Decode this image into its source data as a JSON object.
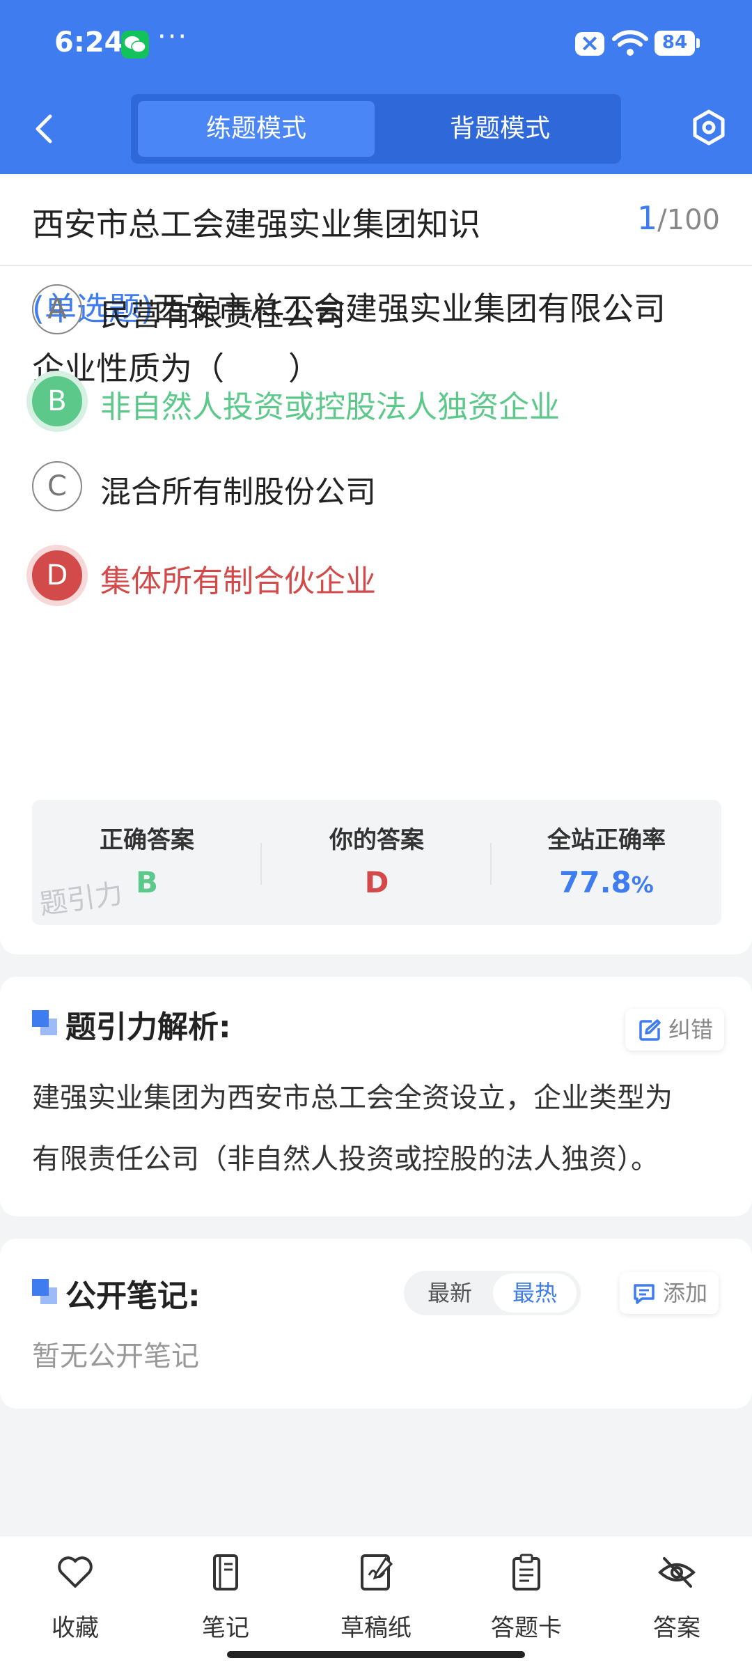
{
  "status_bar": {
    "time": "6:24",
    "more": "···",
    "battery": "84"
  },
  "header": {
    "modes": [
      "练题模式",
      "背题模式"
    ],
    "active_mode": "练题模式",
    "accent": "#3f7cf0"
  },
  "question": {
    "title": "西安市总工会建强实业集团知识",
    "current": "1",
    "total": "/100",
    "type": "(单选题)",
    "text_line1": "西安市总工会建强实业集团有限公司",
    "text_line2": "企业性质为（　　）",
    "options": [
      {
        "letter": "A",
        "text": "民营有限责任公司",
        "state": "none"
      },
      {
        "letter": "B",
        "text": "非自然人投资或控股法人独资企业",
        "state": "correct"
      },
      {
        "letter": "C",
        "text": "混合所有制股份公司",
        "state": "none"
      },
      {
        "letter": "D",
        "text": "集体所有制合伙企业",
        "state": "wrong"
      }
    ],
    "colors": {
      "correct": "#5cc98a",
      "wrong": "#d34a4a"
    }
  },
  "stats": {
    "correct_label": "正确答案",
    "correct_value": "B",
    "yours_label": "你的答案",
    "yours_value": "D",
    "rate_label": "全站正确率",
    "rate_value": "77.8",
    "rate_unit": "%",
    "watermark": "题引力"
  },
  "analysis": {
    "title": "题引力解析:",
    "report_label": "纠错",
    "line1": "建强实业集团为西安市总工会全资设立，企业类型为",
    "line2": "有限责任公司（非自然人投资或控股的法人独资）。"
  },
  "notes": {
    "title": "公开笔记:",
    "sort_new": "最新",
    "sort_hot": "最热",
    "add_label": "添加",
    "empty": "暂无公开笔记"
  },
  "bottom_nav": [
    "收藏",
    "笔记",
    "草稿纸",
    "答题卡",
    "答案"
  ]
}
